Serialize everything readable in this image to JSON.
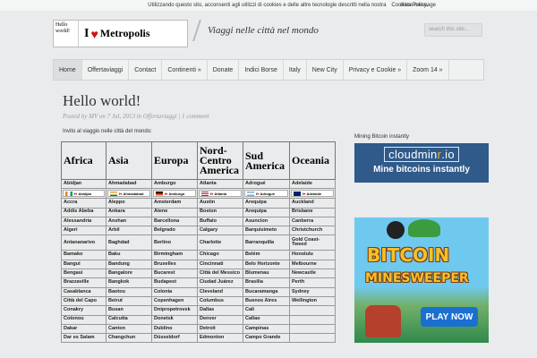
{
  "cookie_bar": {
    "text": "Utilizzando questo sito, acconsenti agli utilizzi di cookies e delle altre tecnologie descritti nella nostra",
    "policy_link": "Cookies Policy.",
    "close_link": "close message"
  },
  "header": {
    "logo_small_line1": "Hello",
    "logo_small_line2": "world!",
    "logo_i": "I",
    "logo_heart": "♥",
    "logo_name": "Metropolis",
    "tagline": "Viaggi nelle città nel mondo",
    "search_placeholder": "search this site..."
  },
  "nav": [
    {
      "label": "Home",
      "active": true
    },
    {
      "label": "Offertaviaggi"
    },
    {
      "label": "Contact"
    },
    {
      "label": "Continenti »"
    },
    {
      "label": "Donate"
    },
    {
      "label": "Indici Borse"
    },
    {
      "label": "Italy"
    },
    {
      "label": "New City"
    },
    {
      "label": "Privacy e Cookie »"
    },
    {
      "label": "Zoom 14 »"
    }
  ],
  "post": {
    "title": "Hello world!",
    "meta": "Posted by MV on 7 Jul, 2013 in Offertaviaggi | 1 comment",
    "intro": "Invito al viaggio nelle città del mondo:"
  },
  "table": {
    "headers": [
      "Africa",
      "Asia",
      "Europa",
      "Nord-Centro America",
      "Sud America",
      "Oceania"
    ],
    "first_row": [
      "Abidjan",
      "Ahmadabad",
      "Amburgo",
      "Atlanta",
      "Adrogué",
      "Adelaide"
    ],
    "banner_row": [
      "Abidjan",
      "Ahmadabad",
      "Amburgo",
      "Atlanta",
      "Adrogué",
      "Adelaide"
    ],
    "rows": [
      [
        "Accra",
        "Aleppo",
        "Amsterdam",
        "Austin",
        "Arequipa",
        "Auckland"
      ],
      [
        "Addis Abeba",
        "Ankara",
        "Atene",
        "Boston",
        "Arequipa",
        "Brisbane"
      ],
      [
        "Alessandria",
        "Anshan",
        "Barcellona",
        "Buffalo",
        "Asuncion",
        "Canberra"
      ],
      [
        "Algeri",
        "Arbil",
        "Belgrado",
        "Calgary",
        "Barquisimeto",
        "Christchurch"
      ],
      [
        "Antananarivo",
        "Baghdad",
        "Berlino",
        "Charlotte",
        "Barranquilla",
        "Gold Coast-Tweed"
      ],
      [
        "Bamako",
        "Baku",
        "Birmingham",
        "Chicago",
        "Belém",
        "Honolulu"
      ],
      [
        "Bangui",
        "Bandung",
        "Bruxelles",
        "Cincinnati",
        "Belo Horizonte",
        "Melbourne"
      ],
      [
        "Bengasi",
        "Bangalore",
        "Bucarest",
        "Città del Messico",
        "Blumenau",
        "Newcastle"
      ],
      [
        "Brazzaville",
        "Bangkok",
        "Budapest",
        "Ciudad Juárez",
        "Brasilia",
        "Perth"
      ],
      [
        "Casablanca",
        "Baotou",
        "Colonia",
        "Cleveland",
        "Bucaramanga",
        "Sydney"
      ],
      [
        "Città del Capo",
        "Beirut",
        "Copenhagen",
        "Columbus",
        "Buenos Aires",
        "Wellington"
      ],
      [
        "Conakry",
        "Busan",
        "Dnipropetrovsk",
        "Dallas",
        "Cali",
        ""
      ],
      [
        "Cotonou",
        "Calcutta",
        "Donetsk",
        "Denver",
        "Callao",
        ""
      ],
      [
        "Dakar",
        "Canton",
        "Dublino",
        "Detroit",
        "Campinas",
        ""
      ],
      [
        "Dar es Salam",
        "Changchun",
        "Düsseldorf",
        "Edmonton",
        "Campo Grande",
        ""
      ]
    ]
  },
  "sidebar": {
    "ad1_label": "Mining Bitcoin instantly",
    "ad1_logo_a": "cloudmin",
    "ad1_logo_dot": "r",
    "ad1_logo_b": ".io",
    "ad1_text": "Mine bitcoins instantly",
    "ad2_title1": "BITCOIN",
    "ad2_title2": "MINESWEEPER",
    "ad2_button": "PLAY NOW"
  }
}
